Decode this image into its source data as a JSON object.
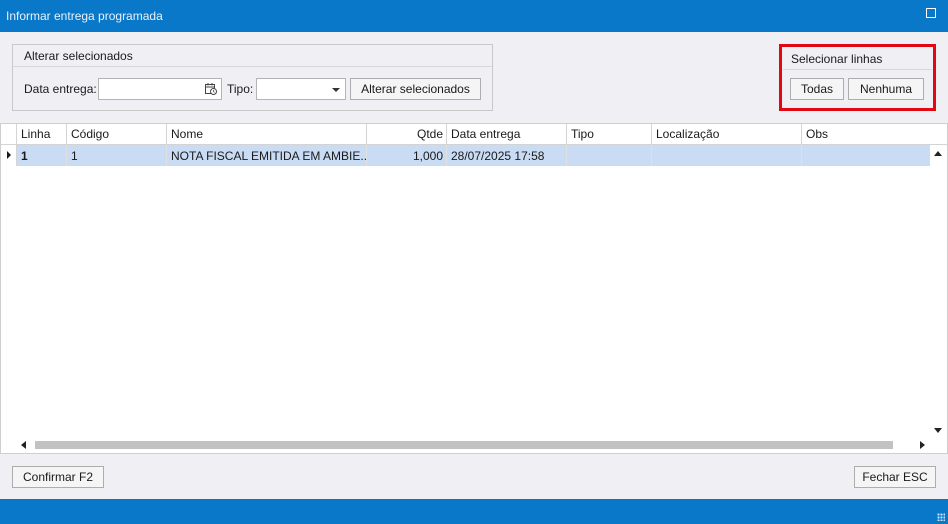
{
  "window": {
    "title": "Informar entrega programada"
  },
  "alter_group": {
    "title": "Alterar selecionados",
    "date_label": "Data entrega:",
    "date_value": "",
    "type_label": "Tipo:",
    "type_value": "",
    "apply_button": "Alterar selecionados"
  },
  "select_group": {
    "title": "Selecionar linhas",
    "all_button": "Todas",
    "none_button": "Nenhuma"
  },
  "grid": {
    "columns": [
      "Linha",
      "Código",
      "Nome",
      "Qtde",
      "Data entrega",
      "Tipo",
      "Localização",
      "Obs"
    ],
    "rows": [
      {
        "linha": "1",
        "codigo": "1",
        "nome": "NOTA FISCAL EMITIDA EM AMBIE...",
        "qtde": "1,000",
        "data_entrega": "28/07/2025 17:58",
        "tipo": "",
        "localizacao": "",
        "obs": ""
      }
    ]
  },
  "footer": {
    "confirm_button": "Confirmar F2",
    "close_button": "Fechar ESC"
  },
  "colors": {
    "titlebar": "#0a78c8",
    "selected_row": "#c9dcf3",
    "highlight_border": "#e30613"
  },
  "icons": [
    "maximize-icon",
    "calendar-icon",
    "chevron-down-icon",
    "row-indicator-icon",
    "scroll-up-icon",
    "scroll-down-icon",
    "scroll-left-icon",
    "scroll-right-icon",
    "resize-grip-icon"
  ]
}
